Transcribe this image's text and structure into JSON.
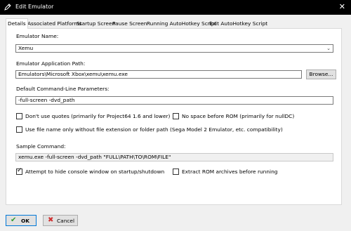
{
  "window": {
    "title": "Edit Emulator"
  },
  "tabs": [
    {
      "label": "Details"
    },
    {
      "label": "Associated Platforms"
    },
    {
      "label": "Startup Screen"
    },
    {
      "label": "Pause Screen"
    },
    {
      "label": "Running AutoHotkey Script"
    },
    {
      "label": "Exit AutoHotkey Script"
    }
  ],
  "form": {
    "emulator_name_label": "Emulator Name:",
    "emulator_name_value": "Xemu",
    "app_path_label": "Emulator Application Path:",
    "app_path_value": "Emulators\\Microsoft Xbox\\xemu\\xemu.exe",
    "browse_label": "Browse...",
    "params_label": "Default Command-Line Parameters:",
    "params_value": "-full-screen -dvd_path",
    "opt_no_quotes": "Don't use quotes (primarily for Project64 1.6 and lower)",
    "opt_no_space": "No space before ROM (primarily for nullDC)",
    "opt_filename_only": "Use file name only without file extension or folder path (Sega Model 2 Emulator, etc. compatibility)",
    "sample_label": "Sample Command:",
    "sample_value": "xemu.exe -full-screen -dvd_path \"FULL\\PATH\\TO\\ROM\\FILE\"",
    "opt_hide_console": "Attempt to hide console window on startup/shutdown",
    "opt_extract_rom": "Extract ROM archives before running"
  },
  "checkboxes": {
    "no_quotes": false,
    "no_space": false,
    "filename_only": false,
    "hide_console": true,
    "extract_rom": false
  },
  "footer": {
    "ok_label": "OK",
    "cancel_label": "Cancel"
  },
  "colors": {
    "ok_icon": "#2e9b2e",
    "cancel_icon": "#d03030",
    "accent": "#0078d7"
  }
}
